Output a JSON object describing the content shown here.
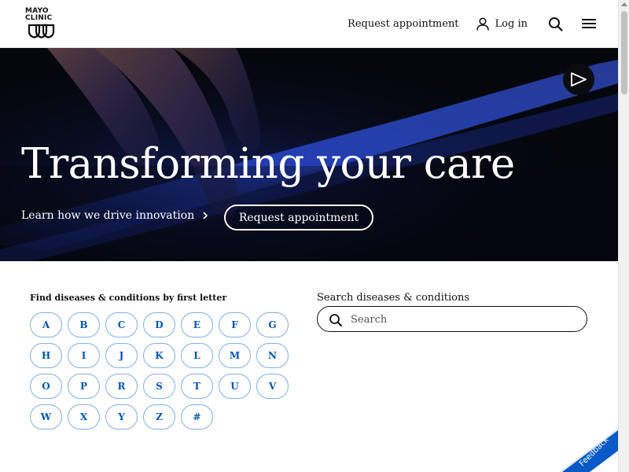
{
  "header": {
    "logo": {
      "line1": "MAYO",
      "line2": "CLINIC"
    },
    "nav": {
      "request_appointment": "Request appointment",
      "login": "Log in"
    },
    "icons": {
      "login": "user-icon",
      "search": "search-icon",
      "menu": "hamburger-menu-icon"
    }
  },
  "hero": {
    "title": "Transforming your care",
    "link_text": "Learn how we drive innovation",
    "button_label": "Request appointment",
    "play_icon": "play-icon"
  },
  "find_by_letter": {
    "label": "Find diseases & conditions by first letter",
    "letters": [
      "A",
      "B",
      "C",
      "D",
      "E",
      "F",
      "G",
      "H",
      "I",
      "J",
      "K",
      "L",
      "M",
      "N",
      "O",
      "P",
      "R",
      "S",
      "T",
      "U",
      "V",
      "W",
      "X",
      "Y",
      "Z",
      "#"
    ]
  },
  "search": {
    "label": "Search diseases & conditions",
    "placeholder": "Search",
    "value": ""
  },
  "feedback": {
    "label": "Feedback"
  },
  "colors": {
    "link_blue": "#0057b8",
    "letter_border": "#7fb0e8",
    "feedback_blue": "#0a59c8",
    "hero_bg": "#05070d"
  }
}
